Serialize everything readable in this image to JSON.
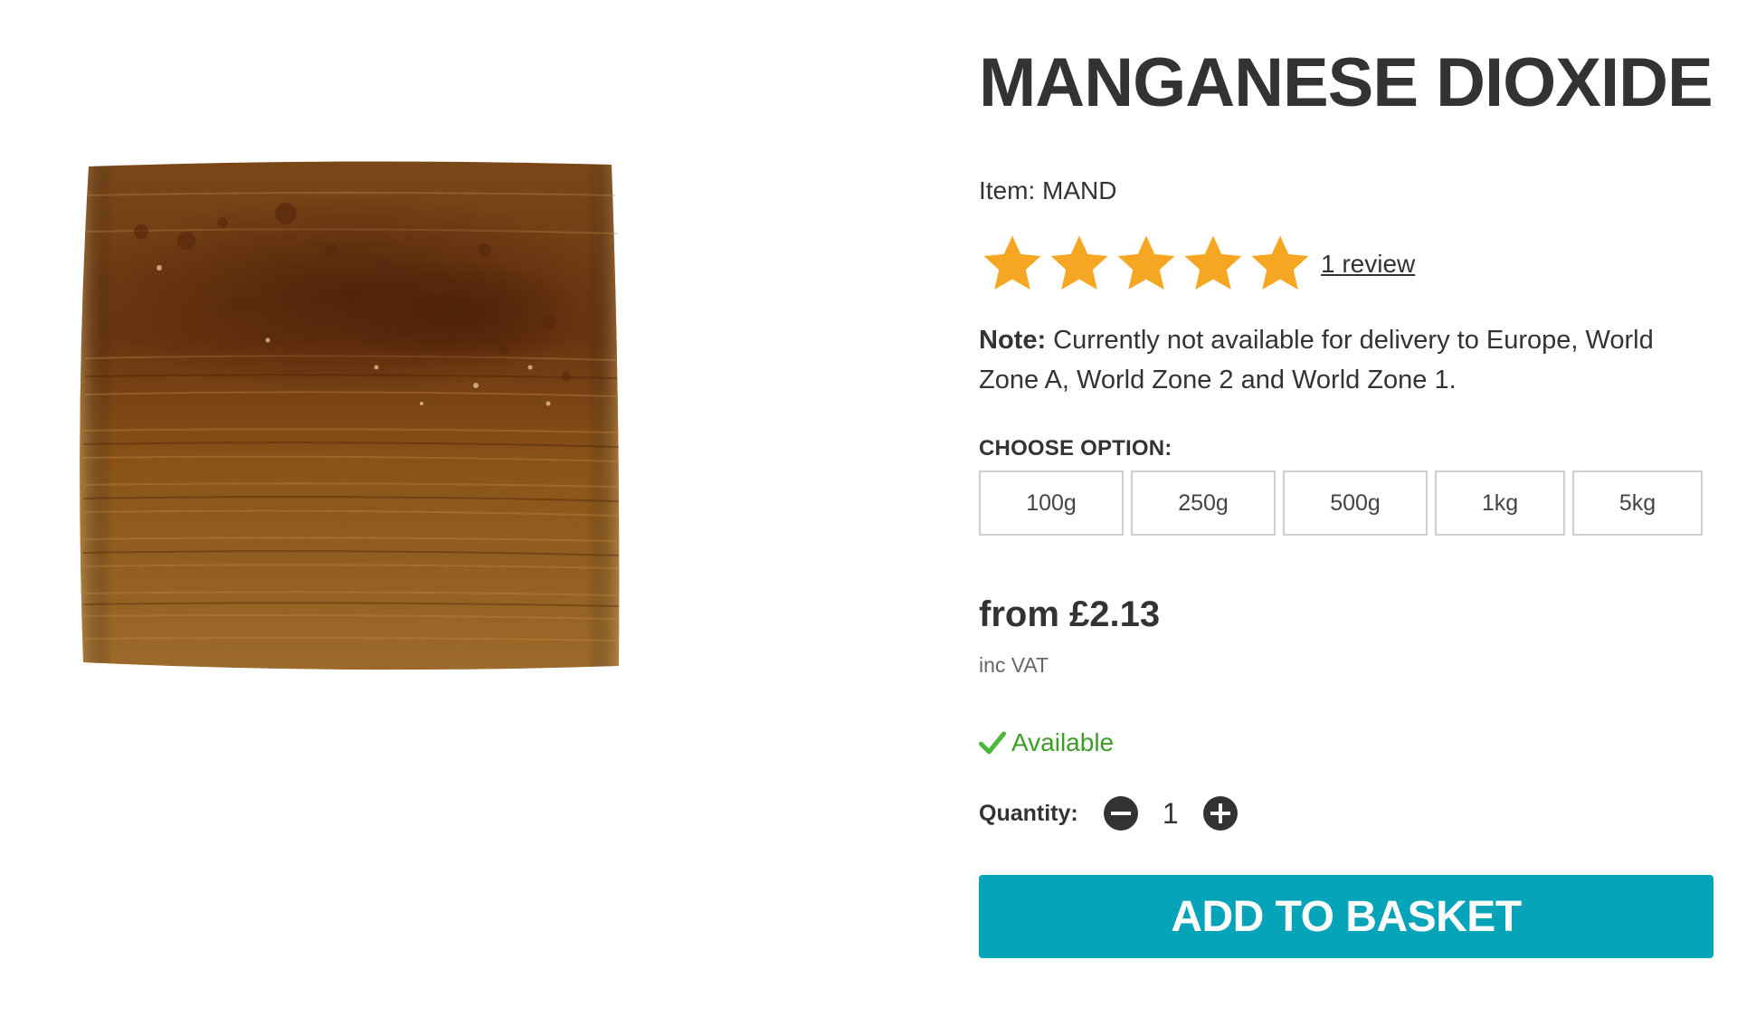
{
  "product": {
    "title": "MANGANESE DIOXIDE",
    "item_code": "Item: MAND",
    "image_alt_icon": "glazed-tile-image"
  },
  "rating": {
    "stars": 5,
    "max_stars": 5,
    "star_color": "#f5a623",
    "review_link": "1 review"
  },
  "note": {
    "label": "Note:",
    "text": " Currently not available for delivery to Europe, World Zone A, World Zone 2 and World Zone 1."
  },
  "options": {
    "label": "CHOOSE OPTION:",
    "items": [
      "100g",
      "250g",
      "500g",
      "1kg",
      "5kg"
    ]
  },
  "pricing": {
    "price": "from £2.13",
    "vat": "inc VAT"
  },
  "availability": {
    "icon": "check-icon",
    "text": "Available",
    "color": "#3a9e27"
  },
  "quantity": {
    "label": "Quantity:",
    "value": "1",
    "decrease_icon": "minus-circle-icon",
    "increase_icon": "plus-circle-icon"
  },
  "cta": {
    "label": "ADD TO BASKET",
    "color": "#06a4b8"
  }
}
